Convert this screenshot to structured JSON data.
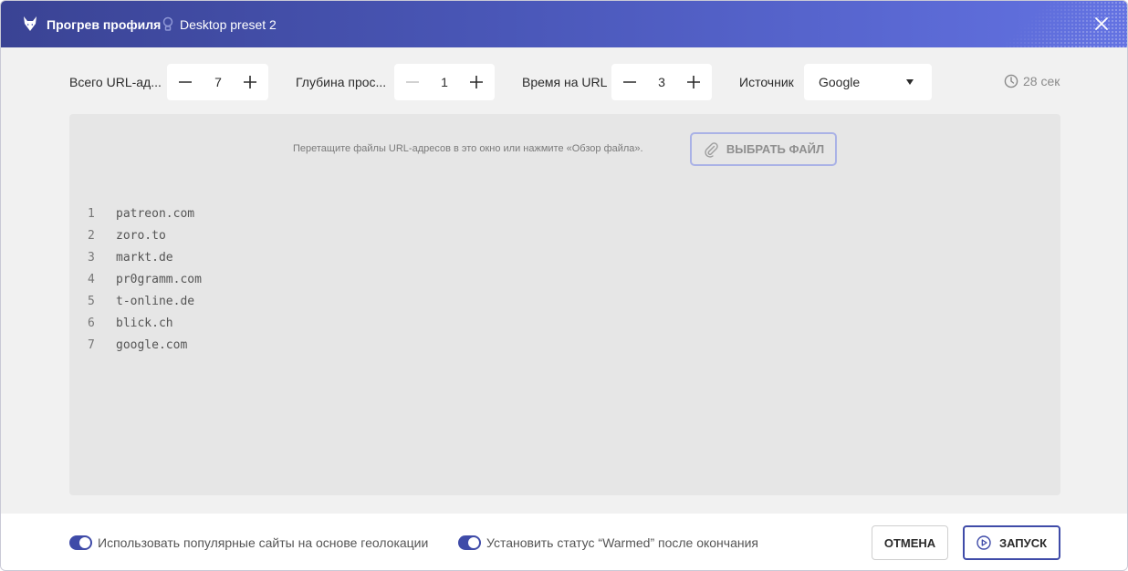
{
  "header": {
    "title": "Прогрев профиля",
    "preset": "Desktop preset 2",
    "logo_icon": "wolf-logo-icon",
    "preset_icon": "bulb-icon",
    "close_icon": "close-icon"
  },
  "toolbar": {
    "total_urls": {
      "label": "Всего URL-ад...",
      "value": "7"
    },
    "depth": {
      "label": "Глубина прос...",
      "value": "1"
    },
    "time_per_url": {
      "label": "Время на URL",
      "value": "3"
    },
    "source": {
      "label": "Источник",
      "value": "Google"
    },
    "timer": "28 сек"
  },
  "dropzone": {
    "hint": "Перетащите файлы URL-адресов в это окно или нажмите «Обзор файла».",
    "choose_file": "ВЫБРАТЬ ФАЙЛ"
  },
  "urls": [
    {
      "n": "1",
      "url": "patreon.com"
    },
    {
      "n": "2",
      "url": "zoro.to"
    },
    {
      "n": "3",
      "url": "markt.de"
    },
    {
      "n": "4",
      "url": "pr0gramm.com"
    },
    {
      "n": "5",
      "url": "t-online.de"
    },
    {
      "n": "6",
      "url": "blick.ch"
    },
    {
      "n": "7",
      "url": "google.com"
    }
  ],
  "footer": {
    "geo_toggle": {
      "label": "Использовать популярные сайты на основе геолокации",
      "on": true
    },
    "warmed_toggle": {
      "label": "Установить статус “Warmed” после окончания",
      "on": true
    },
    "cancel": "ОТМЕНА",
    "launch": "ЗАПУСК"
  },
  "colors": {
    "accent": "#3f4ba8",
    "header_start": "#3a4394",
    "header_end": "#6372e2"
  }
}
